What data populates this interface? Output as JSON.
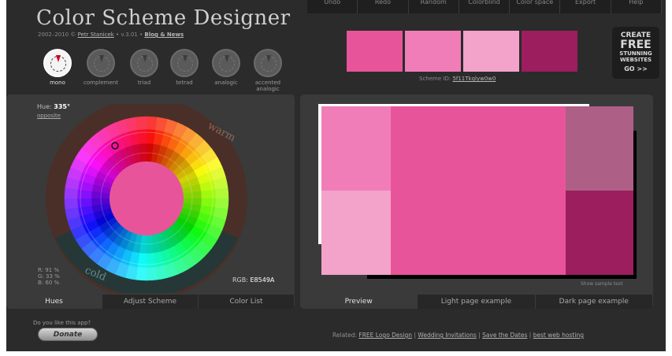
{
  "header": {
    "title": "Color Scheme Designer",
    "credits_prefix": "2002–2010 © ",
    "credits_author": "Petr Stanicek",
    "credits_version": " • v.3.01 • ",
    "credits_news": "Blog & News"
  },
  "top_menu": [
    "Undo",
    "Redo",
    "Random",
    "Colorblind",
    "Color space",
    "Export",
    "Help"
  ],
  "modes": [
    {
      "label": "mono",
      "icon": "mono-icon"
    },
    {
      "label": "complement",
      "icon": "complement-icon"
    },
    {
      "label": "triad",
      "icon": "triad-icon"
    },
    {
      "label": "tetrad",
      "icon": "tetrad-icon"
    },
    {
      "label": "analogic",
      "icon": "analogic-icon"
    },
    {
      "label": "accented analogic",
      "icon": "accented-analogic-icon"
    }
  ],
  "active_mode": "mono",
  "swatches": [
    "#E8549A",
    "#F17DB8",
    "#F3A2CA",
    "#9C1E5E"
  ],
  "scheme_id_label": "Scheme ID:",
  "scheme_id_value": "5f11Tkqlyw0w0",
  "ad": {
    "line1": "CREATE",
    "line2": "FREE",
    "line3a": "STUNNING",
    "line3b": "WEBSITES",
    "line4": "GO >>"
  },
  "left_panel": {
    "hue_label": "Hue:",
    "hue_value": "335°",
    "opposite": "opposite",
    "wheel_warm": "warm",
    "wheel_cold": "cold",
    "rgb_pct": {
      "r": "R: 91 %",
      "g": "G: 33 %",
      "b": "B: 60 %"
    },
    "rgb_label": "RGB:",
    "rgb_value": "E8549A",
    "tabs": [
      "Hues",
      "Adjust Scheme",
      "Color List"
    ]
  },
  "right_panel": {
    "show_sample": "Show sample text",
    "tabs": [
      "Preview",
      "Light page example",
      "Dark page example"
    ]
  },
  "footer": {
    "like_text": "Do you like this app?",
    "donate": "Donate",
    "related_label": "Related:",
    "related_links": [
      "FREE Logo Design",
      "Wedding Invitations",
      "Save the Dates",
      "best web hosting"
    ]
  },
  "colors": {
    "primary": "#E8549A",
    "light1": "#F17DB8",
    "light2": "#F3A2CA",
    "dark": "#9C1E5E",
    "mauve": "#AE5F85"
  }
}
